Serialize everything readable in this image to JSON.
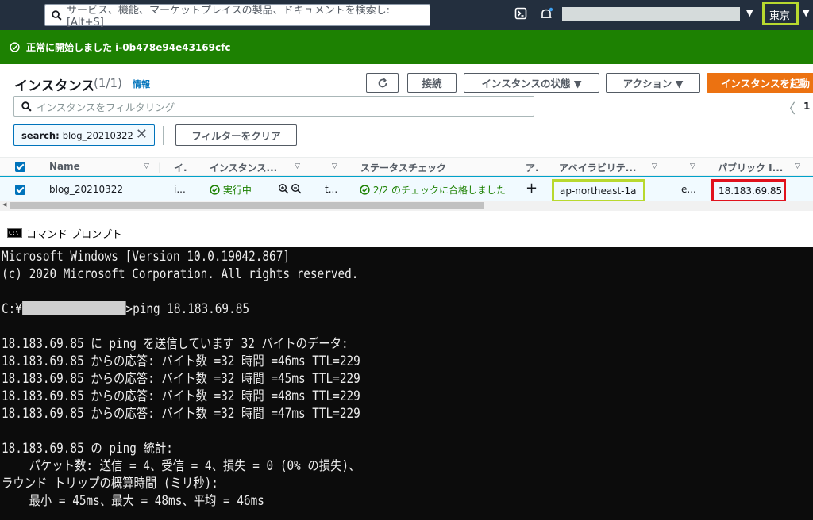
{
  "topbar": {
    "search_placeholder": "サービス、機能、マーケットプレイスの製品、ドキュメントを検索し: [Alt+S]",
    "region": "東京",
    "colors": {
      "bar": "#232f3e",
      "highlight": "#b8d92f"
    }
  },
  "flash": {
    "message": "正常に開始しました i-0b478e94e43169cfc",
    "color": "#1d8102"
  },
  "instances": {
    "title": "インスタンス",
    "count": "(1/1)",
    "info": "情報",
    "buttons": {
      "refresh_icon": "refresh-icon",
      "connect": "接続",
      "state": "インスタンスの状態 ▼",
      "actions": "アクション ▼",
      "launch": "インスタンスを起動"
    },
    "filter_placeholder": "インスタンスをフィルタリング",
    "pager": {
      "prev": "〈",
      "page": "1"
    },
    "token": {
      "key": "search:",
      "value": "blog_20210322"
    },
    "clear_filters": "フィルターをクリア",
    "columns": {
      "name": "Name",
      "id": "イ.",
      "type": "インスタンス...",
      "status_check": "ステータスチェック",
      "alarm": "ア.",
      "az": "アベイラビリテ...",
      "public_ip": "パブリック I..."
    },
    "row": {
      "name": "blog_20210322",
      "id": "i...",
      "state": "実行中",
      "type": "t...",
      "status_check": "2/2 のチェックに合格しました",
      "alarm": "+",
      "az": "ap-northeast-1a",
      "dns": "e...",
      "public_ip": "18.183.69.85"
    }
  },
  "cmd": {
    "title": "コマンド プロンプト",
    "icon_label": "C:\\",
    "lines": {
      "l1": "Microsoft Windows [Version 10.0.19042.867]",
      "l2": "(c) 2020 Microsoft Corporation. All rights reserved.",
      "prompt_prefix": "C:¥",
      "prompt_cmd": ">ping 18.183.69.85",
      "l4": "18.183.69.85 に ping を送信しています 32 バイトのデータ:",
      "r1": "18.183.69.85 からの応答: バイト数 =32 時間 =46ms TTL=229",
      "r2": "18.183.69.85 からの応答: バイト数 =32 時間 =45ms TTL=229",
      "r3": "18.183.69.85 からの応答: バイト数 =32 時間 =48ms TTL=229",
      "r4": "18.183.69.85 からの応答: バイト数 =32 時間 =47ms TTL=229",
      "s1": "18.183.69.85 の ping 統計:",
      "s2": "    パケット数: 送信 = 4、受信 = 4、損失 = 0 (0% の損失)、",
      "s3": "ラウンド トリップの概算時間 (ミリ秒):",
      "s4": "    最小 = 45ms、最大 = 48ms、平均 = 46ms"
    }
  }
}
